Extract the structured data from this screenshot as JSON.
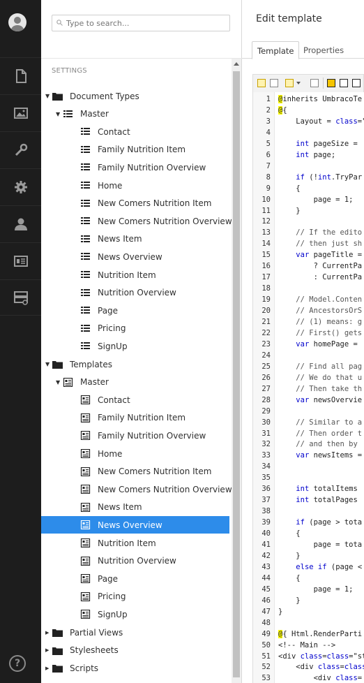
{
  "sidebar_icons": [
    "content-icon",
    "media-icon",
    "developer-icon",
    "settings-icon",
    "users-icon",
    "members-icon",
    "forms-icon"
  ],
  "search": {
    "placeholder": "Type to search..."
  },
  "tree": {
    "section_label": "SETTINGS",
    "nodes": [
      {
        "label": "Document Types",
        "level": 0,
        "icon": "folder",
        "arrow": "down"
      },
      {
        "label": "Master",
        "level": 1,
        "icon": "doctype",
        "arrow": "down"
      },
      {
        "label": "Contact",
        "level": 2,
        "icon": "doctype"
      },
      {
        "label": "Family Nutrition Item",
        "level": 2,
        "icon": "doctype"
      },
      {
        "label": "Family Nutrition Overview",
        "level": 2,
        "icon": "doctype"
      },
      {
        "label": "Home",
        "level": 2,
        "icon": "doctype"
      },
      {
        "label": "New Comers Nutrition Item",
        "level": 2,
        "icon": "doctype"
      },
      {
        "label": "New Comers Nutrition Overview",
        "level": 2,
        "icon": "doctype"
      },
      {
        "label": "News Item",
        "level": 2,
        "icon": "doctype"
      },
      {
        "label": "News Overview",
        "level": 2,
        "icon": "doctype"
      },
      {
        "label": "Nutrition Item",
        "level": 2,
        "icon": "doctype"
      },
      {
        "label": "Nutrition Overview",
        "level": 2,
        "icon": "doctype"
      },
      {
        "label": "Page",
        "level": 2,
        "icon": "doctype"
      },
      {
        "label": "Pricing",
        "level": 2,
        "icon": "doctype"
      },
      {
        "label": "SignUp",
        "level": 2,
        "icon": "doctype"
      },
      {
        "label": "Templates",
        "level": 0,
        "icon": "folder",
        "arrow": "down"
      },
      {
        "label": "Master",
        "level": 1,
        "icon": "template",
        "arrow": "down"
      },
      {
        "label": "Contact",
        "level": 2,
        "icon": "template"
      },
      {
        "label": "Family Nutrition Item",
        "level": 2,
        "icon": "template"
      },
      {
        "label": "Family Nutrition Overview",
        "level": 2,
        "icon": "template"
      },
      {
        "label": "Home",
        "level": 2,
        "icon": "template"
      },
      {
        "label": "New Comers Nutrition Item",
        "level": 2,
        "icon": "template"
      },
      {
        "label": "New Comers Nutrition Overview",
        "level": 2,
        "icon": "template"
      },
      {
        "label": "News Item",
        "level": 2,
        "icon": "template"
      },
      {
        "label": "News Overview",
        "level": 2,
        "icon": "template",
        "selected": true
      },
      {
        "label": "Nutrition Item",
        "level": 2,
        "icon": "template"
      },
      {
        "label": "Nutrition Overview",
        "level": 2,
        "icon": "template"
      },
      {
        "label": "Page",
        "level": 2,
        "icon": "template"
      },
      {
        "label": "Pricing",
        "level": 2,
        "icon": "template"
      },
      {
        "label": "SignUp",
        "level": 2,
        "icon": "template"
      },
      {
        "label": "Partial Views",
        "level": 0,
        "icon": "folder",
        "arrow": "right"
      },
      {
        "label": "Stylesheets",
        "level": 0,
        "icon": "folder",
        "arrow": "right"
      },
      {
        "label": "Scripts",
        "level": 0,
        "icon": "folder",
        "arrow": "right"
      }
    ]
  },
  "editor": {
    "title": "Edit template",
    "tabs": [
      "Template",
      "Properties"
    ],
    "active_tab": "Template",
    "lines": [
      "@inherits UmbracoTe",
      "@{",
      "    Layout = \"umbMa",
      "",
      "    int pageSize = ",
      "    int page;",
      "",
      "    if (!int.TryPar",
      "    {",
      "        page = 1;",
      "    }",
      "",
      "    // If the edito",
      "    // then just sh",
      "    var pageTitle =",
      "        ? CurrentPa",
      "        : CurrentPa",
      "",
      "    // Model.Conten",
      "    // AncestorsOrS",
      "    // (1) means: g",
      "    // First() gets",
      "    var homePage = ",
      "",
      "    // Find all pag",
      "    // We do that u",
      "    // Then take th",
      "    var newsOvervie",
      "",
      "    // Similar to a",
      "    // Then order t",
      "    // and then by ",
      "    var newsItems =",
      "",
      "",
      "    int totalItems ",
      "    int totalPages ",
      "",
      "    if (page > tota",
      "    {",
      "        page = tota",
      "    }",
      "    else if (page <",
      "    {",
      "        page = 1;",
      "    }",
      "}",
      "",
      "@{ Html.RenderParti",
      "<!-- Main -->",
      "<div class=\"contain",
      "    <div class=\"row",
      "        <div class="
    ]
  }
}
